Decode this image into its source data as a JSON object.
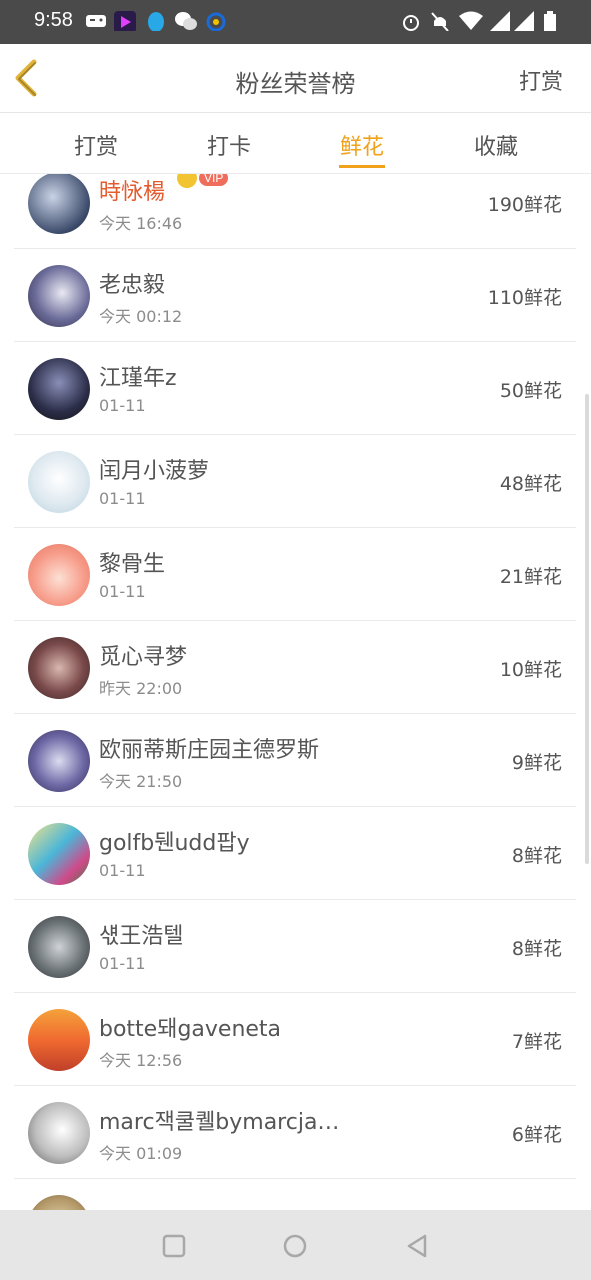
{
  "status_bar": {
    "time": "9:58",
    "icons": [
      "gamepad-icon",
      "video-app-icon",
      "qq-icon",
      "wechat-icon",
      "phone-app-icon",
      "alarm-icon",
      "mute-icon",
      "wifi-icon",
      "signal-icon",
      "signal-icon",
      "battery-icon"
    ]
  },
  "header": {
    "back_icon": "chevron-left-icon",
    "title": "粉丝荣誉榜",
    "right_label": "打赏"
  },
  "tabs": [
    {
      "label": "打赏",
      "active": false
    },
    {
      "label": "打卡",
      "active": false
    },
    {
      "label": "鲜花",
      "active": true
    },
    {
      "label": "收藏",
      "active": false
    }
  ],
  "accent_color": "#f0a21a",
  "vip_badge": {
    "label": "VIP"
  },
  "fans": [
    {
      "name": "時怺楊",
      "time": "今天 16:46",
      "amount": "190鲜花",
      "vip": true
    },
    {
      "name": "老忠毅",
      "time": "今天 00:12",
      "amount": "110鲜花",
      "vip": false
    },
    {
      "name": "江瑾年z",
      "time": "01-11",
      "amount": "50鲜花",
      "vip": false
    },
    {
      "name": "闰月小菠萝",
      "time": "01-11",
      "amount": "48鲜花",
      "vip": false
    },
    {
      "name": "黎骨生",
      "time": "01-11",
      "amount": "21鲜花",
      "vip": false
    },
    {
      "name": "觅心寻梦",
      "time": "昨天 22:00",
      "amount": "10鲜花",
      "vip": false
    },
    {
      "name": "欧丽蒂斯庄园主德罗斯",
      "time": "今天 21:50",
      "amount": "9鲜花",
      "vip": false
    },
    {
      "name": "golfb뒌udd팝y",
      "time": "01-11",
      "amount": "8鲜花",
      "vip": false
    },
    {
      "name": "섃王浩텔",
      "time": "01-11",
      "amount": "8鲜花",
      "vip": false
    },
    {
      "name": "botte돼gaveneta",
      "time": "今天 12:56",
      "amount": "7鲜花",
      "vip": false
    },
    {
      "name": "marc잭쿨퀠bymarcja…",
      "time": "今天 01:09",
      "amount": "6鲜花",
      "vip": false
    }
  ],
  "nav_bar": [
    "recent-apps-icon",
    "home-icon",
    "back-icon"
  ]
}
